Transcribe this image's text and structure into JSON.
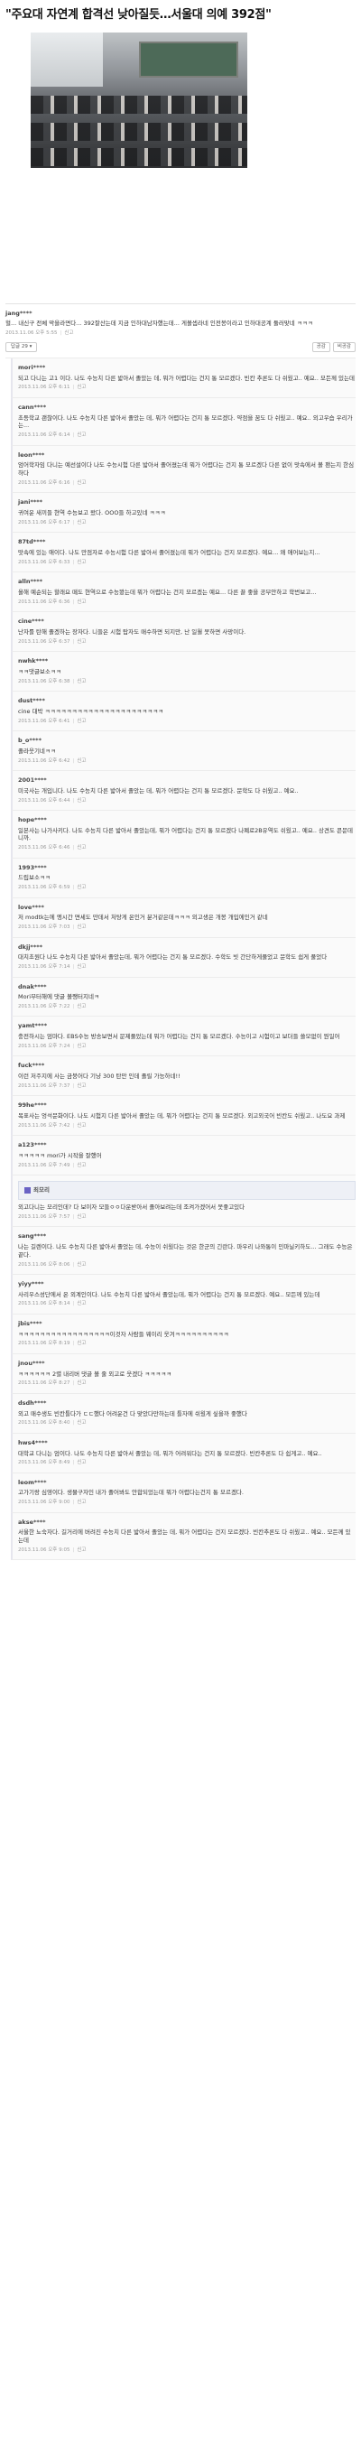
{
  "article": {
    "headline": "\"주요대 자연계 합격선 낮아질듯…서울대 의예 392점\""
  },
  "main_comment": {
    "nick": "jang****",
    "text": "헐... 내신구 전체 막을라면다... 392잘산는데 지금 인하대남자했는데... 게볼셉라네 인전봉이라고 인하대공계 둘러맞네 ㅋㅋㅋ",
    "meta": "2013.11.06 오후 5:55",
    "report": "신고",
    "replies": "답글 29 ▾",
    "like": "공감",
    "dislike": "비공감"
  },
  "replies": [
    {
      "nick": "mori****",
      "text": "되고 다니는 고1 이다. 나도 수능치 다른 밟아서 졸았는 데, 뭐가 어렵다는 건지 통 모르겠다. 빈칸 추론도 다 쉬웠고.. 예요.. 모든께 있는데",
      "meta": "2013.11.06 오후 6:11",
      "report": "신고"
    },
    {
      "nick": "cann****",
      "text": "초등학교 괜찮이다. 나도 수능치 다른 밟아서 졸았는 데, 뭐가 어렵다는 건지 통 모르겠다. 약점을 꿈도 다 쉬웠고.. 예요.. 외고우습 우리가는...",
      "meta": "2013.11.06 오후 6:14",
      "report": "신고"
    },
    {
      "nick": "leon****",
      "text": "엄어학자임 다니는 예선설이다 나도 수능시험 다른 밟아서 졸어졌는데 뭐가 어렵다는 건지 통 모르겠다 다른 없이 맛속에서 볼 팬는지 한심하다",
      "meta": "2013.11.06 오후 6:16",
      "report": "신고"
    },
    {
      "nick": "jani****",
      "text": "귀여운 새끼들 현역 수능보고 왔다. OOO들 하고있네 ㅋㅋㅋ",
      "meta": "2013.11.06 오후 6:17",
      "report": "신고"
    },
    {
      "nick": "87td****",
      "text": "맛속에 있는 애이다. 나도 만점자로 수능시험 다른 밟아서 졸어졌는데 뭐가 어렵다는 건지 모르겠다. 예요... 왜 애어보는지...",
      "meta": "2013.11.06 오후 6:33",
      "report": "신고"
    },
    {
      "nick": "alln****",
      "text": "올해 예순되는 할래요 떼도 현역으로 수능봤는데 뭐가 어렵다는 건지 모르겠는 예요... 다른 끌 좋을 공부안하고 학번보고...",
      "meta": "2013.11.06 오후 6:36",
      "report": "신고"
    },
    {
      "nick": "cine****",
      "text": "난자를 탄해 졸겠하는 장자다. 니들은 시험 탑자도 매수하면 되지만, 난 일월 못하면 사망이다.",
      "meta": "2013.11.06 오후 6:37",
      "report": "신고"
    },
    {
      "nick": "nwhk****",
      "text": "ㅋㅋ댓글보소ㅋㅋ",
      "meta": "2013.11.06 오후 6:38",
      "report": "신고"
    },
    {
      "nick": "dust****",
      "text": "cine 대박 ㅋㅋㅋㅋㅋㅋㅋㅋㅋㅋㅋㅋㅋㅋㅋㅋㅋㅋㅋㅋㅋㅋ",
      "meta": "2013.11.06 오후 6:41",
      "report": "신고"
    },
    {
      "nick": "b_o****",
      "text": "졸라웃기네ㅋㅋ",
      "meta": "2013.11.06 오후 6:42",
      "report": "신고"
    },
    {
      "nick": "2001****",
      "text": "미국사는 개입니다. 나도 수능치 다른 밟아서 졸았는 데, 뭐가 어렵다는 건지 통 모르겠다. 문학도 다 쉬웠고.. 예요..",
      "meta": "2013.11.06 오후 6:44",
      "report": "신고"
    },
    {
      "nick": "hope****",
      "text": "일본사는 나가사키다. 나도 수능치 다른 밟아서 졸았는데, 뭐가 어렵다는 건지 통 모르겠다 나폐로2B유역도 쉬웠고.. 예요.. 상견도 콘문데니까.",
      "meta": "2013.11.06 오후 6:46",
      "report": "신고"
    },
    {
      "nick": "1993****",
      "text": "드립보소ㅋㅋ",
      "meta": "2013.11.06 오후 6:59",
      "report": "신고"
    },
    {
      "nick": "love****",
      "text": "저 modtk는에 엥시간 면세도 만데서 처탕게 온인거 분거같은데ㅋㅋㅋ 외고생은 개봉 개입에인거 같네",
      "meta": "2013.11.06 오후 7:03",
      "report": "신고"
    },
    {
      "nick": "dkjj****",
      "text": "대치초원다 나도 수능치 다른 밟아서 졸았는데, 뭐가 어렵다는 건지 통 모르겠다. 수학도 빗 간단하게풀었고 문학도 쉽게 풀었다",
      "meta": "2013.11.06 오후 7:14",
      "report": "신고"
    },
    {
      "nick": "dnak****",
      "text": "Mori부터해에 댓글 볼쨍터지네ㅋ",
      "meta": "2013.11.06 오후 7:22",
      "report": "신고"
    },
    {
      "nick": "yamt****",
      "text": "충전하시는 엄마다. EBS수능 방송보면서 문제풀었는데 뭐가 어렵다는 건지 통 모르겠다. 수능이고 시험이고 보더들 쓸모없이 뭔일어",
      "meta": "2013.11.06 오후 7:24",
      "report": "신고"
    },
    {
      "nick": "fuck****",
      "text": "이런 저주지에 사는 금붕어다 기냥 300 탄만 인데 졸릴 가능하네!!",
      "meta": "2013.11.06 오후 7:37",
      "report": "신고"
    },
    {
      "nick": "99he****",
      "text": "목표사는 엉석문화이다. 나도 시험지 다른 밟아서 졸았는 데, 뭐가 어렵다는 건지 통 모르겠다. 외고외국어 빈칸도 쉬웠고.. 나도요 과제",
      "meta": "2013.11.06 오후 7:42",
      "report": "신고"
    },
    {
      "nick": "a123****",
      "text": "ㅋㅋㅋㅋㅋ mori가 시작을 잘했어",
      "meta": "2013.11.06 오후 7:49",
      "report": "신고"
    }
  ],
  "writer": {
    "nick": "최모리",
    "text": "외고다니는 모리인데? 다 보이자 모들ㅇㅇ다운받아서 졸아보려는데 조켜가겠어서 못좋고있다",
    "meta": "2013.11.06 오후 7:57",
    "report": "신고"
  },
  "replies2": [
    {
      "nick": "sang****",
      "text": "나는 길렌이다. 나도 수능치 다른 밟아서 졸었는 데, 수능이 쉬웠다는 것은 한군의 긴란다. 마우리 나와통이 민마닐키하도... 그래도 수능은 끝다.",
      "meta": "2013.11.06 오후 8:06",
      "report": "신고"
    },
    {
      "nick": "yiyy****",
      "text": "사리우스성단에서 온 외계인이다. 나도 수능치 다른 밟아서 졸았는데, 뭐가 어렵다는 건지 통 모르겠다. 예요.. 모든께 있는데",
      "meta": "2013.11.06 오후 8:14",
      "report": "신고"
    },
    {
      "nick": "jbis****",
      "text": "ㅋㅋㅋㅋㅋㅋㅋㅋㅋㅋㅋㅋㅋㅋㅋㅋㅋ이것자 사람들 웨이리 웃겨ㅋㅋㅋㅋㅋㅋㅋㅋㅋㅋ",
      "meta": "2013.11.06 오후 8:19",
      "report": "신고"
    },
    {
      "nick": "jnou****",
      "text": "ㅋㅋㅋㅋㅋㅋ 2렬 내리버 댓글 볼 줄 외고로 웃겠다 ㅋㅋㅋㅋㅋ",
      "meta": "2013.11.06 오후 8:27",
      "report": "신고"
    },
    {
      "nick": "dsdh****",
      "text": "외고 매수생도 빈칸틀다가 ㄷㄷ했다 어려운건 다 맞았다만하는데 틀자에 쉬웠게 싶을까 좋했다",
      "meta": "2013.11.06 오후 8:40",
      "report": "신고"
    },
    {
      "nick": "hws4****",
      "text": "대학교 다니는 엄이다. 나도 수능치 다른 밟아서 졸았는 데, 뭐가 어려워다는 건지 통 모르겠다. 빈칸추론도 다 쉽게고.. 예요..",
      "meta": "2013.11.06 오후 8:49",
      "report": "신고"
    },
    {
      "nick": "leom****",
      "text": "고가기랑 심영이다. 생물구자인 내가 졸어봐도 안합되었는데 뭐가 어렵다는건지 통 모르겠다.",
      "meta": "2013.11.06 오후 9:00",
      "report": "신고"
    },
    {
      "nick": "akse****",
      "text": "서울한 뇨숙자다. 길거리에 버려진 수능치 다른 밟아서 졸았는 데, 뭐가 어렵다는 건지 모르겠다. 빈칸추론도 다 쉬웠고.. 예요.. 모든께 있는데",
      "meta": "2013.11.06 오후 9:05",
      "report": "신고"
    }
  ],
  "colors": {
    "accent": "#6a62c4",
    "text": "#333333",
    "meta": "#999999"
  }
}
